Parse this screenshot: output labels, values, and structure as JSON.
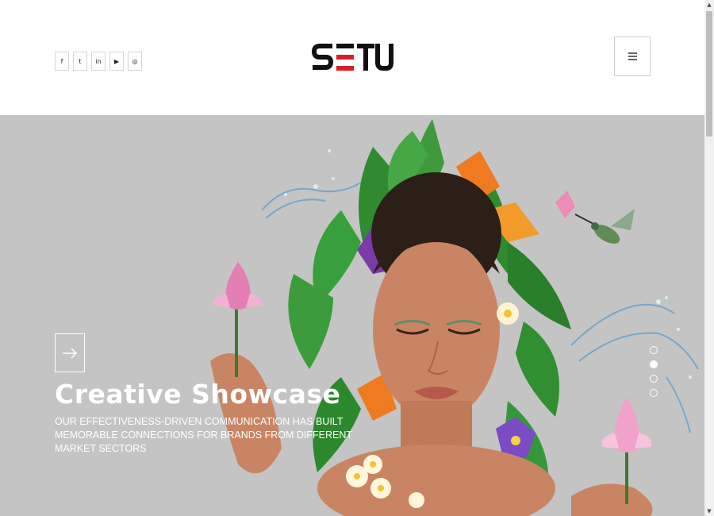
{
  "header": {
    "brand": "SETU",
    "social": [
      {
        "icon": "facebook-icon",
        "glyph": "f"
      },
      {
        "icon": "twitter-icon",
        "glyph": "t"
      },
      {
        "icon": "linkedin-icon",
        "glyph": "in"
      },
      {
        "icon": "youtube-icon",
        "glyph": "▶"
      },
      {
        "icon": "instagram-icon",
        "glyph": "◎"
      }
    ],
    "menu_icon": "hamburger-icon"
  },
  "hero": {
    "title": "Creative Showcase",
    "description": "OUR EFFECTIVENESS-DRIVEN COMMUNICATION HAS BUILT MEMORABLE CONNECTIONS FOR BRANDS FROM DIFFERENT MARKET SECTORS",
    "arrow_icon": "arrow-right-icon",
    "slides_count": 4,
    "active_slide": 1
  },
  "colors": {
    "brand_black": "#111111",
    "brand_red": "#d81f26",
    "hero_bg": "#c4c4c4",
    "leaf_green": "#2e8b2e",
    "text_white": "#ffffff"
  }
}
